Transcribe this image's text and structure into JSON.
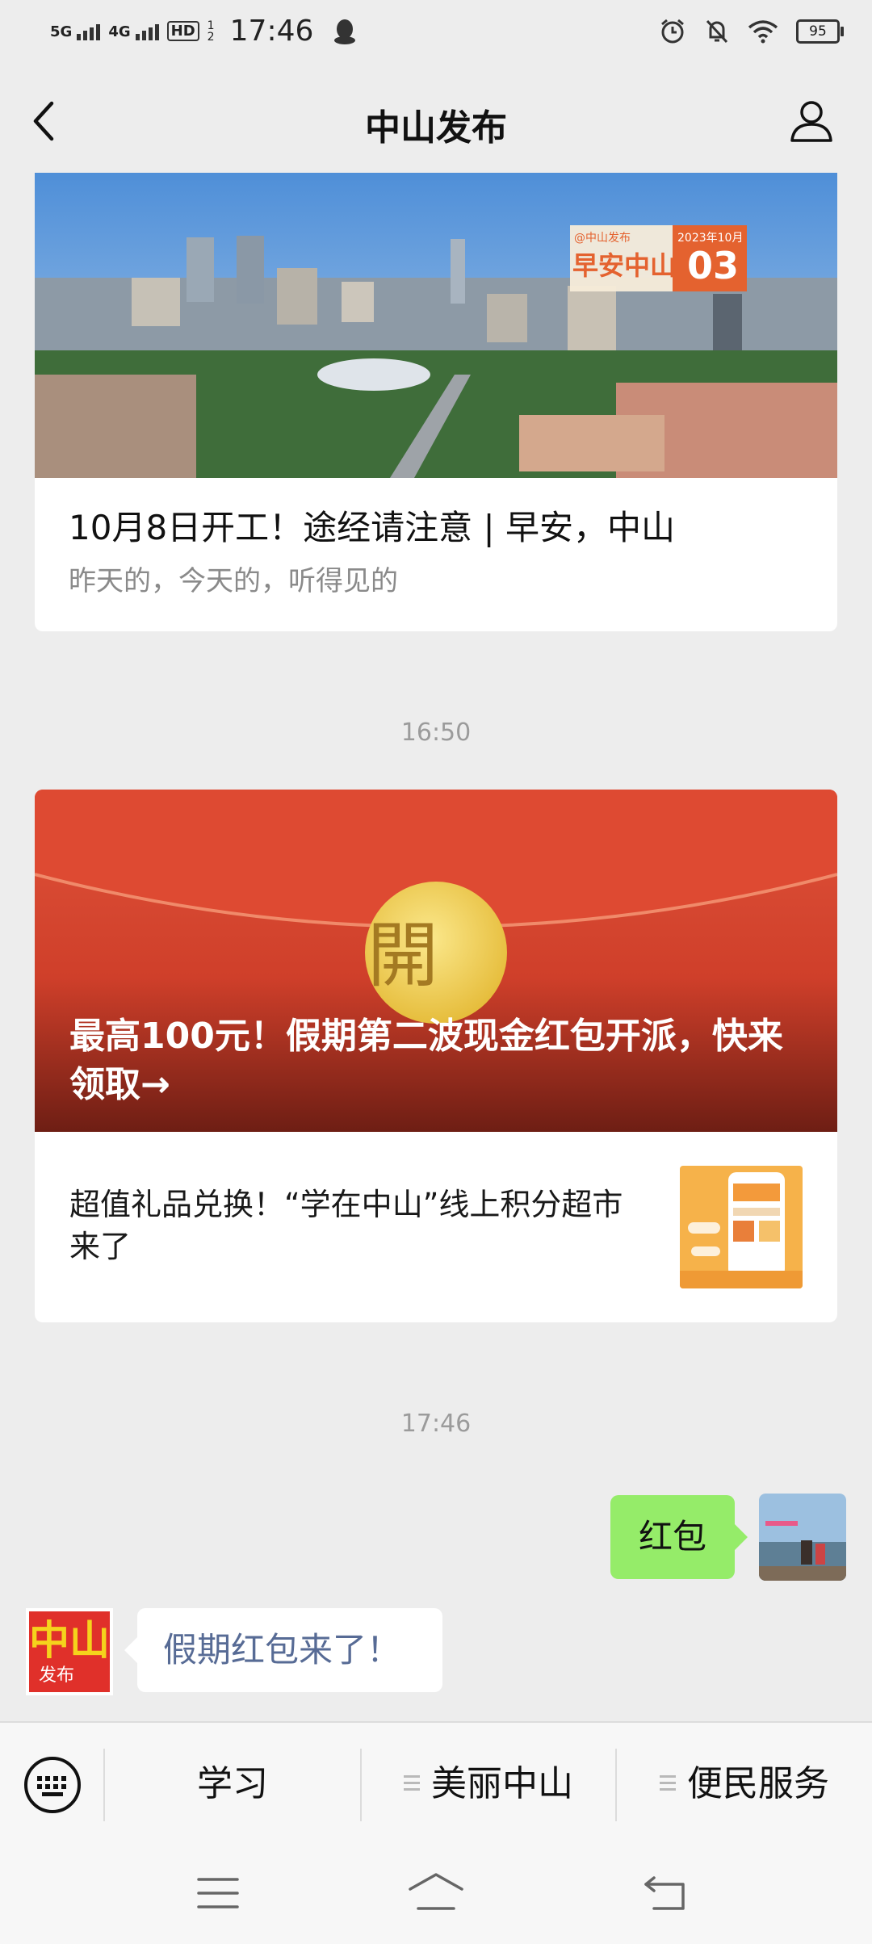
{
  "status_bar": {
    "time": "17:46",
    "signal1": "5G",
    "signal2": "4G",
    "hd": "HD",
    "hd_sub": "1 2",
    "battery": "95"
  },
  "nav": {
    "title": "中山发布"
  },
  "article1": {
    "badge_brand": "@中山发布",
    "badge_text": "早安中山",
    "badge_month": "2023年10月",
    "badge_day": "03",
    "title": "10月8日开工！途经请注意 | 早安，中山",
    "subtitle": "昨天的，今天的，听得见的"
  },
  "times": {
    "t1": "16:50",
    "t2": "17:46"
  },
  "article2": {
    "envelope_char": "開",
    "main_title": "最高100元！假期第二波现金红包开派，快来领取→",
    "sub_title": "超值礼品兑换！“学在中山”线上积分超市来了"
  },
  "chat": {
    "user_message": "红包",
    "bot_reply": "假期红包来了！",
    "bot_logo_text": "中山",
    "bot_logo_sub": "发布"
  },
  "menu": {
    "items": [
      {
        "label": "学习"
      },
      {
        "label": "美丽中山"
      },
      {
        "label": "便民服务"
      }
    ]
  },
  "colors": {
    "background": "#ededed",
    "card": "#ffffff",
    "bubble_me": "#95ec69",
    "link_text": "#576b95",
    "red_envelope": "#d9432e",
    "envelope_seal": "#f2cf55"
  }
}
